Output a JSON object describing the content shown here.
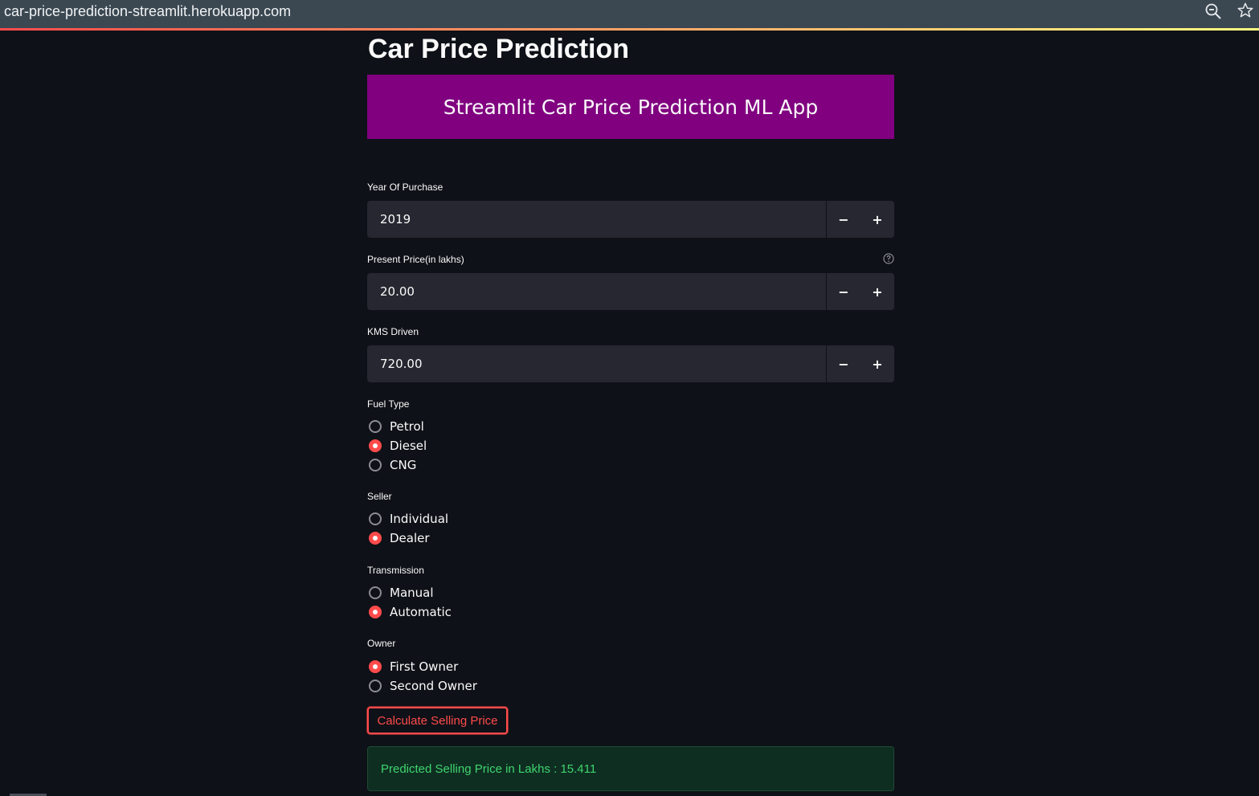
{
  "browser": {
    "url": "car-price-prediction-streamlit.herokuapp.com"
  },
  "page": {
    "title": "Car Price Prediction",
    "banner": "Streamlit Car Price Prediction ML App"
  },
  "fields": {
    "year": {
      "label": "Year Of Purchase",
      "value": "2019"
    },
    "present_price": {
      "label": "Present Price(in lakhs)",
      "value": "20.00"
    },
    "kms_driven": {
      "label": "KMS Driven",
      "value": "720.00"
    },
    "step_minus": "−",
    "step_plus": "+"
  },
  "fuel_type": {
    "label": "Fuel Type",
    "options": [
      "Petrol",
      "Diesel",
      "CNG"
    ],
    "selected": "Diesel"
  },
  "seller": {
    "label": "Seller",
    "options": [
      "Individual",
      "Dealer"
    ],
    "selected": "Dealer"
  },
  "transmission": {
    "label": "Transmission",
    "options": [
      "Manual",
      "Automatic"
    ],
    "selected": "Automatic"
  },
  "owner": {
    "label": "Owner",
    "options": [
      "First Owner",
      "Second Owner"
    ],
    "selected": "First Owner"
  },
  "actions": {
    "calculate_label": "Calculate Selling Price"
  },
  "result": {
    "text": "Predicted Selling Price in Lakhs : 15.411"
  },
  "colors": {
    "accent": "#ff4b4b",
    "banner": "#800080",
    "background": "#0e1117",
    "input": "#262730",
    "success_text": "#3dd56d"
  },
  "icons": [
    "zoom-icon",
    "star-icon",
    "help-icon"
  ]
}
